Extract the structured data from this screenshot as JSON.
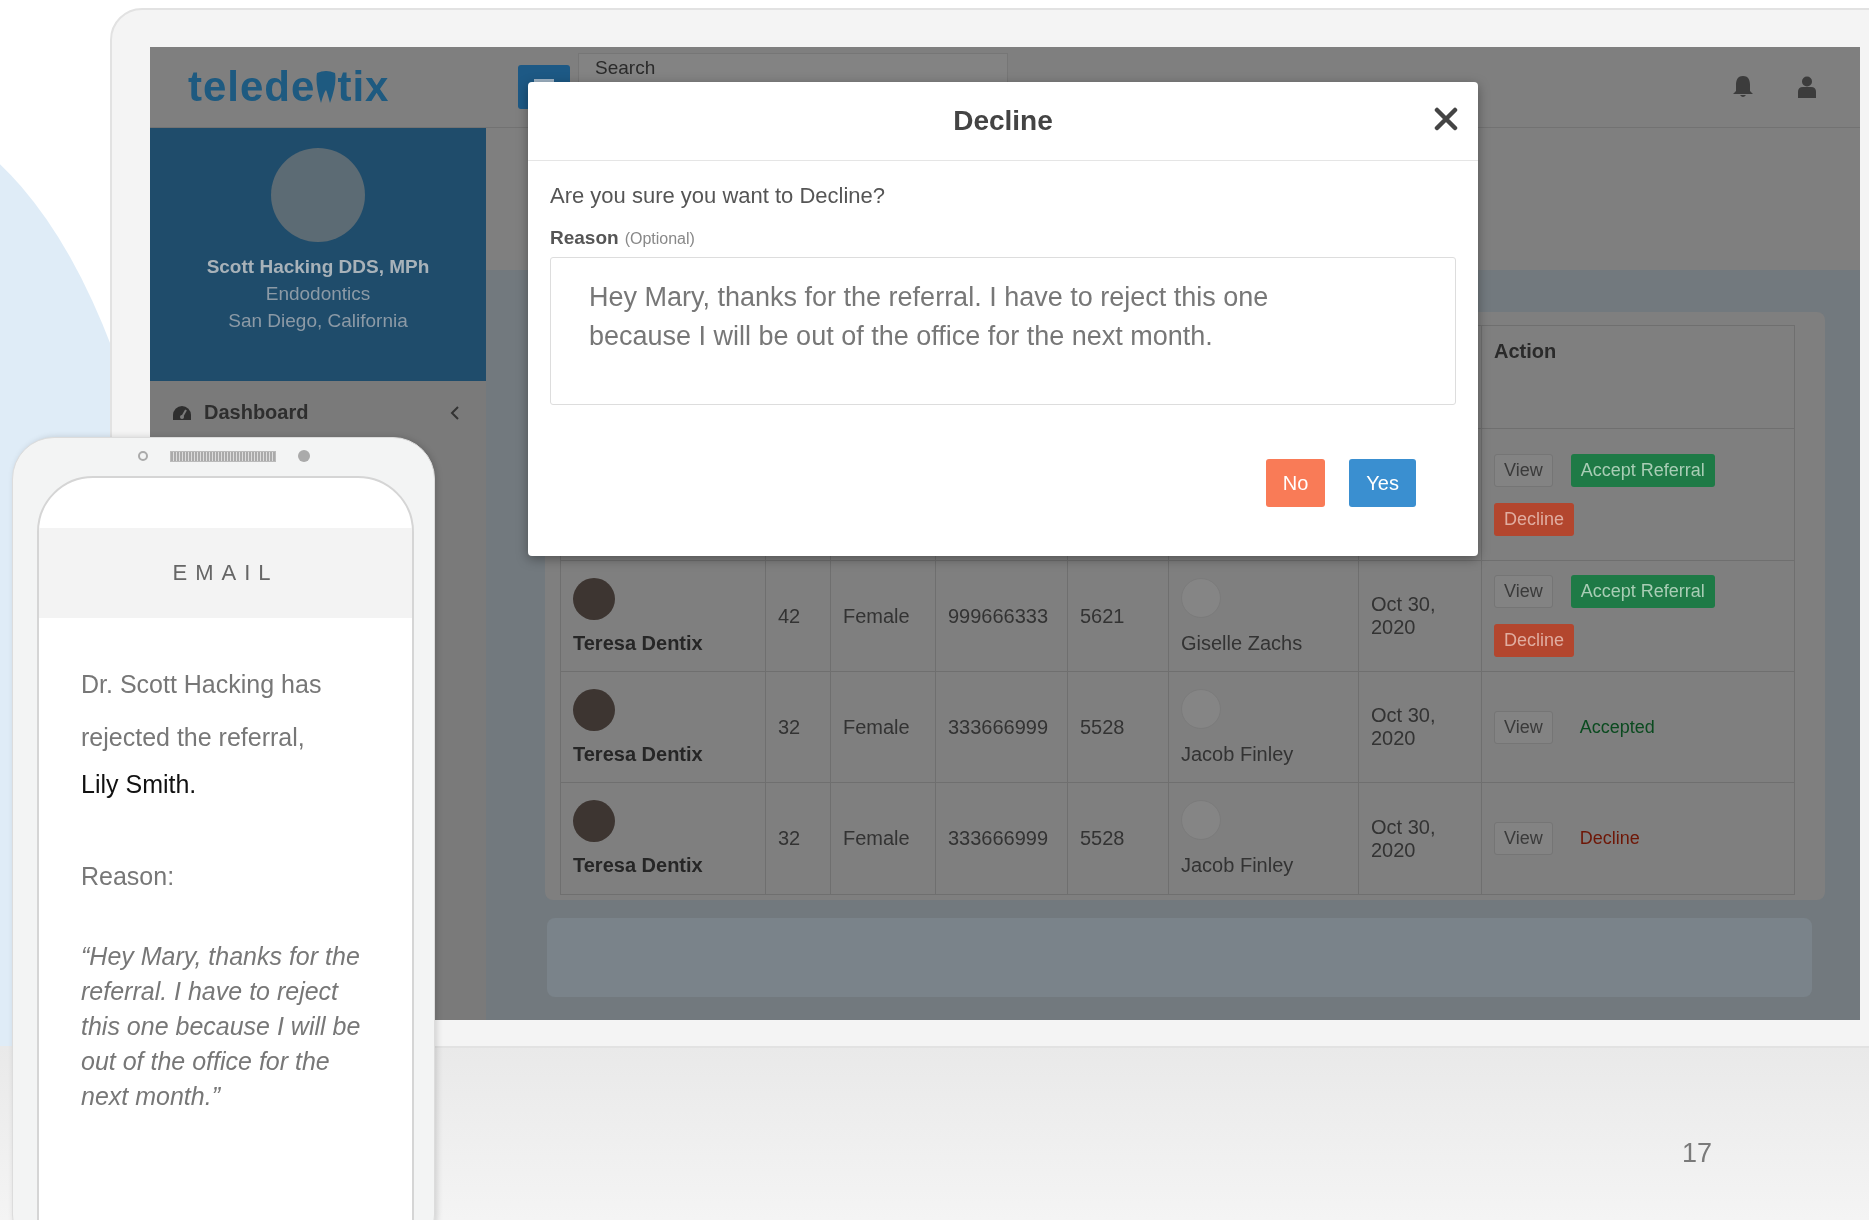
{
  "app": {
    "logo": {
      "before": "telede",
      "after": "tix"
    },
    "search": {
      "placeholder": "Search"
    },
    "profile": {
      "name": "Scott Hacking DDS, MPh",
      "specialty": "Endodontics",
      "location": "San Diego, California"
    },
    "nav": [
      {
        "label": "Dashboard",
        "selected": false
      }
    ],
    "table": {
      "action_header": "Action",
      "rows": [
        {
          "cells": [],
          "actions": [
            {
              "kind": "view",
              "label": "View"
            },
            {
              "kind": "accept",
              "label": "Accept Referral"
            },
            {
              "kind": "decline",
              "label": "Decline"
            }
          ]
        },
        {
          "cells": [
            "Teresa Dentix",
            "42",
            "Female",
            "999666333",
            "5621",
            "Giselle Zachs",
            "Oct 30, 2020"
          ],
          "actions": [
            {
              "kind": "view",
              "label": "View"
            },
            {
              "kind": "accept",
              "label": "Accept Referral"
            },
            {
              "kind": "decline",
              "label": "Decline"
            }
          ]
        },
        {
          "cells": [
            "Teresa Dentix",
            "32",
            "Female",
            "333666999",
            "5528",
            "Jacob Finley",
            "Oct 30, 2020"
          ],
          "actions": [
            {
              "kind": "view",
              "label": "View"
            },
            {
              "kind": "accepted",
              "label": "Accepted"
            }
          ]
        },
        {
          "cells": [
            "Teresa Dentix",
            "32",
            "Female",
            "333666999",
            "5528",
            "Jacob Finley",
            "Oct 30, 2020"
          ],
          "actions": [
            {
              "kind": "view",
              "label": "View"
            },
            {
              "kind": "declined",
              "label": "Decline"
            }
          ]
        }
      ]
    }
  },
  "modal": {
    "title": "Decline",
    "question": "Are you sure you want to Decline?",
    "reason_label": "Reason",
    "reason_hint": "(Optional)",
    "reason_value": "Hey Mary, thanks for the referral. I have to reject this one because I will be out of the office for the next month.",
    "buttons": [
      {
        "kind": "no",
        "label": "No"
      },
      {
        "kind": "yes",
        "label": "Yes"
      }
    ]
  },
  "phone": {
    "title": "EMAIL",
    "message": "Dr. Scott Hacking has rejected the referral,",
    "recipient": "Lily Smith.",
    "reason_label": "Reason:",
    "quote": "“Hey Mary, thanks for the referral. I have to reject this one because I will be out of the office for the next month.”"
  },
  "slide_number": "17"
}
